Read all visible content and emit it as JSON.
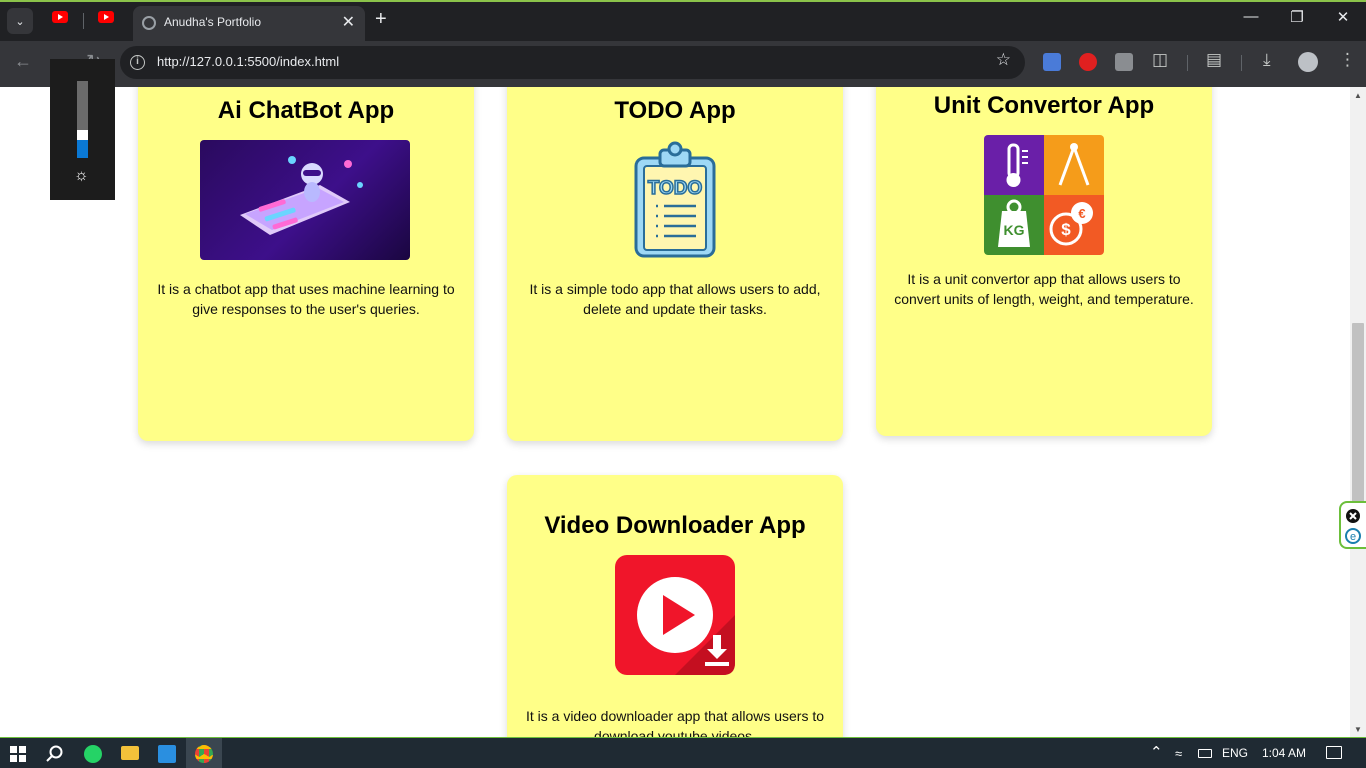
{
  "browser": {
    "tab_title": "Anudha's Portfolio",
    "url": "http://127.0.0.1:5500/index.html"
  },
  "cards": [
    {
      "title": "Ai ChatBot App",
      "description": "It is a chatbot app that uses machine learning to give responses to the user's queries.",
      "image": "chatbot-illustration"
    },
    {
      "title": "TODO App",
      "description": "It is a simple todo app that allows users to add, delete and update their tasks.",
      "image": "todo-clipboard-icon",
      "image_text": "TODO"
    },
    {
      "title": "Unit Convertor App",
      "description": "It is a unit convertor app that allows users to convert units of length, weight, and temperature.",
      "image": "unit-convertor-icon",
      "image_text": "KG"
    },
    {
      "title": "Video Downloader App",
      "description": "It is a video downloader app that allows users to download youtube videos.",
      "image": "video-downloader-icon"
    }
  ],
  "brightness": {
    "level": 0.26
  },
  "taskbar": {
    "language": "ENG",
    "time": "1:04 AM"
  },
  "colors": {
    "card_bg": "#ffff88",
    "browser_dark": "#202124",
    "taskbar": "#1f2a33"
  }
}
